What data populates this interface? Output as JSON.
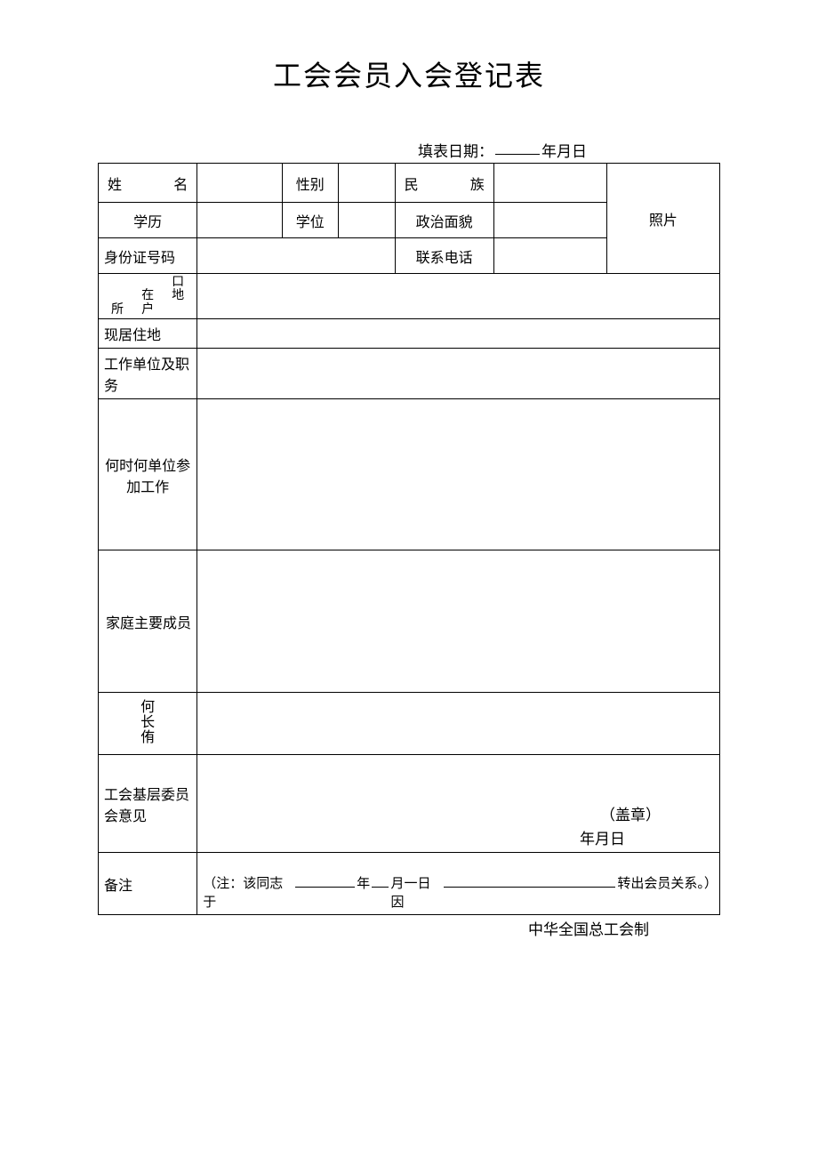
{
  "title": "工会会员入会登记表",
  "dateLabel": "填表日期：",
  "dateSuffix": "年月日",
  "labels": {
    "name": "姓　　名",
    "gender": "性别",
    "ethnicity": "民　　族",
    "education": "学历",
    "degree": "学位",
    "political": "政治面貌",
    "photo": "照片",
    "idNumber": "身份证号码",
    "phone": "联系电话",
    "hukou_kou": "口",
    "hukou_zai": "在",
    "hukou_di": "地",
    "hukou_suo": "所",
    "hukou_hu": "户",
    "residence": "现居住地",
    "workunit": "工作单位及职务",
    "workhistory": "何时何单位参加工作",
    "family": "家庭主要成员",
    "hechang_he": "何",
    "hechang_chang": "长",
    "hechang_you": "侑",
    "opinion": "工会基层委员会意见",
    "notes": "备注"
  },
  "opinionText": {
    "seal": "（盖章）",
    "date": "年月日"
  },
  "notesText": {
    "prefix": "（注：该同志于",
    "mid1": "年",
    "mid2": "月一日因",
    "suffix": "转出会员关系。）"
  },
  "footer": "中华全国总工会制"
}
